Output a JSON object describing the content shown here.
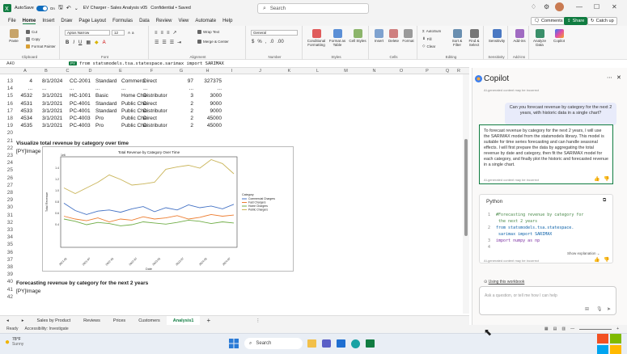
{
  "titlebar": {
    "autosave_label": "AutoSave",
    "autosave_state": "On",
    "doc_title": "EV Charger - Sales Analysis v05",
    "sensitivity": "Confidential • Saved",
    "search_placeholder": "Search"
  },
  "ribbon_tabs": [
    "File",
    "Home",
    "Insert",
    "Draw",
    "Page Layout",
    "Formulas",
    "Data",
    "Review",
    "View",
    "Automate",
    "Help"
  ],
  "active_tab": "Home",
  "tab_actions": {
    "comments": "Comments",
    "share": "Share",
    "catch_up": "Catch up"
  },
  "ribbon": {
    "clipboard": {
      "paste": "Paste",
      "cut": "Cut",
      "copy": "Copy",
      "format_painter": "Format Painter",
      "label": "Clipboard"
    },
    "font": {
      "font_name": "Aptos Narrow",
      "font_size": "12",
      "label": "Font"
    },
    "alignment": {
      "wrap_text": "Wrap Text",
      "merge_center": "Merge & Center",
      "label": "Alignment"
    },
    "number": {
      "format": "General",
      "label": "Number"
    },
    "styles": {
      "conditional": "Conditional Formatting",
      "format_table": "Format as Table",
      "cell_styles": "Cell Styles",
      "label": "Styles"
    },
    "cells": {
      "insert": "Insert",
      "delete": "Delete",
      "format": "Format",
      "label": "Cells"
    },
    "editing": {
      "autosum": "AutoSum",
      "fill": "Fill",
      "clear": "Clear",
      "sort_filter": "Sort & Filter",
      "find_select": "Find & Select",
      "label": "Editing"
    },
    "sensitivity": {
      "button": "Sensitivity",
      "label": "Sensitivity"
    },
    "addins": {
      "button": "Add-ins",
      "label": "Add-ins"
    },
    "analyze": {
      "button": "Analyze Data"
    },
    "copilot": {
      "button": "Copilot"
    }
  },
  "formula_bar": {
    "cell_ref": "A40",
    "fx_badge": "PY",
    "formula": "from statsmodels.tsa.statespace.sarimax import SARIMAX"
  },
  "columns": [
    "A",
    "B",
    "C",
    "D",
    "E",
    "F",
    "G",
    "H",
    "I",
    "J",
    "K",
    "L",
    "M",
    "N",
    "O",
    "P",
    "Q",
    "R",
    "S"
  ],
  "rows": [
    {
      "num": "13",
      "cells": [
        "4",
        "8/1/2024",
        "CC-2001",
        "Standard",
        "Commerci",
        "Direct",
        "",
        "97",
        "327375"
      ]
    },
    {
      "num": "14",
      "cells": [
        "...",
        "...",
        "...",
        "...",
        "...",
        "...",
        "",
        "...",
        "..."
      ]
    },
    {
      "num": "15",
      "cells": [
        "4532",
        "3/1/2021",
        "HC-1001",
        "Basic",
        "Home Cha",
        "Distributor",
        "",
        "3",
        "3000"
      ]
    },
    {
      "num": "16",
      "cells": [
        "4531",
        "3/1/2021",
        "PC-4001",
        "Standard",
        "Public Cha",
        "Direct",
        "",
        "2",
        "9000"
      ]
    },
    {
      "num": "17",
      "cells": [
        "4533",
        "3/1/2021",
        "PC-4001",
        "Standard",
        "Public Cha",
        "Distributor",
        "",
        "2",
        "9000"
      ]
    },
    {
      "num": "18",
      "cells": [
        "4534",
        "3/1/2021",
        "PC-4003",
        "Pro",
        "Public Cha",
        "Direct",
        "",
        "2",
        "45000"
      ]
    },
    {
      "num": "19",
      "cells": [
        "4535",
        "3/1/2021",
        "PC-4003",
        "Pro",
        "Public Cha",
        "Distributor",
        "",
        "2",
        "45000"
      ]
    }
  ],
  "row_numbers_lower": [
    "20",
    "21",
    "22",
    "23",
    "24",
    "25",
    "26",
    "27",
    "28",
    "29",
    "30",
    "31",
    "32",
    "33",
    "34",
    "35",
    "36",
    "37",
    "38",
    "39",
    "40",
    "41",
    "42"
  ],
  "section1": {
    "title": "Visualize total revenue by category over time",
    "image_tag": "[PY]Image"
  },
  "section2": {
    "title": "Forecasting revenue by category for the next 2 years",
    "image_tag": "[PY]Image"
  },
  "chart_data": {
    "type": "line",
    "title": "Total Revenue by Category Over Time",
    "xlabel": "Date",
    "ylabel": "Total Revenue",
    "x": [
      "2021-01",
      "2021-07",
      "2022-01",
      "2022-07",
      "2023-01",
      "2023-07",
      "2024-01",
      "2024-07"
    ],
    "ylim": [
      0,
      1.6
    ],
    "y_ticks": [
      "0.4",
      "0.6",
      "0.8",
      "1.0",
      "1.2",
      "1.4",
      "1e6"
    ],
    "series": [
      {
        "name": "Commercial Chargers",
        "color": "#4472c4",
        "values": [
          0.78,
          0.65,
          0.58,
          0.64,
          0.66,
          0.62,
          0.68,
          0.72,
          0.63,
          0.7,
          0.66,
          0.75,
          0.7,
          0.73,
          0.68,
          0.76
        ]
      },
      {
        "name": "Fast Chargers",
        "color": "#ed7d31",
        "values": [
          0.55,
          0.5,
          0.47,
          0.52,
          0.45,
          0.5,
          0.48,
          0.54,
          0.5,
          0.52,
          0.56,
          0.5,
          0.53,
          0.58,
          0.55,
          0.57
        ]
      },
      {
        "name": "Home Chargers",
        "color": "#70ad47",
        "values": [
          0.5,
          0.46,
          0.4,
          0.44,
          0.42,
          0.38,
          0.4,
          0.45,
          0.43,
          0.41,
          0.44,
          0.48,
          0.46,
          0.42,
          0.45,
          0.43
        ]
      },
      {
        "name": "Public Chargers",
        "color": "#c9b458",
        "values": [
          1.05,
          0.95,
          1.05,
          1.15,
          1.28,
          1.2,
          1.1,
          1.12,
          1.15,
          1.38,
          1.42,
          1.45,
          1.4,
          1.55,
          1.48,
          1.3
        ]
      }
    ],
    "legend_title": "Category",
    "legend_position": "right",
    "grid": false
  },
  "sheet_tabs": [
    "Sales by Product",
    "Reviews",
    "Prices",
    "Customers",
    "Analysis1"
  ],
  "active_sheet": "Analysis1",
  "status": {
    "ready": "Ready",
    "accessibility": "Accessibility: Investigate"
  },
  "copilot": {
    "title": "Copilot",
    "ai_note": "AI-generated content may be incorrect",
    "user_prompt": "Can you forecast revenue by category for the next 2 years, with historic data in a single chart?",
    "response": "To forecast revenue by category for the next 2 years, I will use the SARIMAX model from the statsmodels library. This model is suitable for time series forecasting and can handle seasonal effects. I will first prepare the data by aggregating the total revenue by date and category, then fit the SARIMAX model for each category, and finally plot the historic and forecasted revenue in a single chart.",
    "python_title": "Python",
    "code": [
      {
        "n": "1",
        "t": "#Forecasting revenue by category for",
        "cls": "cm"
      },
      {
        "n": "",
        "t": "   the next 2 years",
        "cls": "cm"
      },
      {
        "n": "2",
        "t": "from statsmodels.tsa.statespace.",
        "cls": "kw"
      },
      {
        "n": "",
        "t": "   sarimax import SARIMAX",
        "cls": "kw"
      },
      {
        "n": "3",
        "t": "import numpy as np",
        "cls": "tx"
      },
      {
        "n": "4",
        "t": "",
        "cls": "tx"
      }
    ],
    "show_explanation": "Show explanation",
    "using_workbook": "Using this workbook",
    "ask_placeholder": "Ask a question, or tell me how I can help"
  },
  "taskbar": {
    "weather_temp": "78°F",
    "weather_desc": "Sunny",
    "search_label": "Search"
  }
}
